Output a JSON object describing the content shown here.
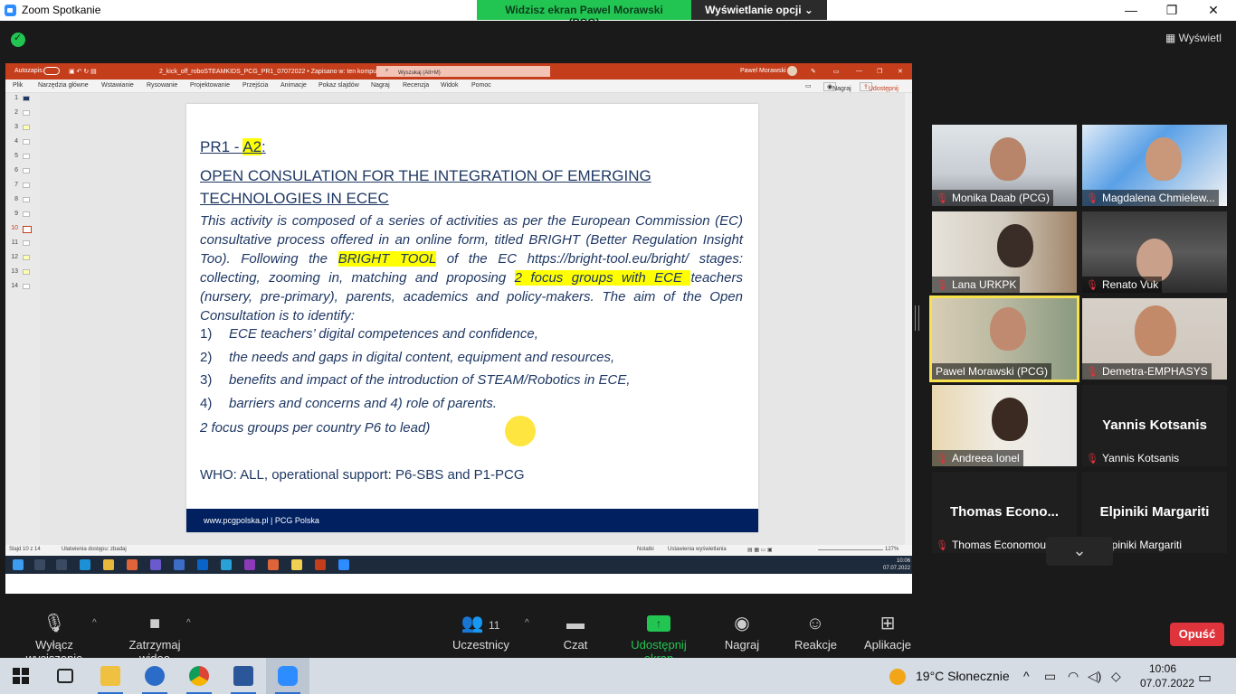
{
  "window": {
    "title": "Zoom Spotkanie",
    "minimize": "—",
    "restore": "❐",
    "close": "✕"
  },
  "share_banner": {
    "viewing": "Widzisz ekran Pawel Morawski (PCG)",
    "options": "Wyświetlanie opcji ⌄"
  },
  "view_toggle": "Wyświetl",
  "powerpoint": {
    "autosave": "Autozapis",
    "filename": "2_kick_off_roboSTEAMKIDS_PCG_PR1_07072022 • Zapisano w: ten komputer ⌄",
    "search_placeholder": "Wyszukaj (Alt+M)",
    "user": "Pawel Morawski",
    "menu": [
      "Plik",
      "Narzędzia główne",
      "Wstawianie",
      "Rysowanie",
      "Projektowanie",
      "Przejścia",
      "Animacje",
      "Pokaz slajdów",
      "Nagraj",
      "Recenzja",
      "Widok",
      "Pomoc"
    ],
    "record": "Nagraj",
    "share": "Udostępnij",
    "thumbnails": [
      "1",
      "2",
      "3",
      "4",
      "5",
      "6",
      "7",
      "8",
      "9",
      "10",
      "11",
      "12",
      "13",
      "14"
    ],
    "active_slide": "10",
    "status_left": "Slajd 10 z 14",
    "status_access": "Ułatwienia dostępu: zbadaj",
    "status_notes": "Notatki",
    "status_view": "Ustawienia wyświetlania",
    "zoom": "127%",
    "inner_clock_time": "10:06",
    "inner_clock_date": "07.07.2022"
  },
  "slide": {
    "title_prefix": "PR1 - ",
    "title_hl": "A2",
    "title_suffix": ":",
    "heading": "OPEN CONSULATION FOR THE INTEGRATION OF EMERGING TECHNOLOGIES IN ECEC",
    "body_1": "This activity is composed of a series of activities as per the European Commission (EC) consultative process offered in an online form, titled BRIGHT (Better Regulation Insight Too). Following the ",
    "body_hl1": "BRIGHT TOOL",
    "body_2": " of the EC https://bright-tool.eu/bright/ stages: collecting, zooming in, matching and proposing ",
    "body_hl2": "2 focus groups with ECE ",
    "body_3": "teachers (nursery, pre-primary), parents, academics and policy-makers. The aim of the Open Consultation is to identify:",
    "list": [
      {
        "num": "1)",
        "text": "ECE teachers’ digital competences and confidence,"
      },
      {
        "num": "2)",
        "text": "the needs and gaps in digital content, equipment and resources,"
      },
      {
        "num": "3)",
        "text": "benefits and impact of the introduction of STEAM/Robotics in ECE,"
      },
      {
        "num": "4)",
        "text": "barriers and concerns and 4) role of parents."
      }
    ],
    "focus_note": "2 focus groups per country P6 to lead)",
    "who": "WHO: ALL, operational support: P6-SBS and P1-PCG",
    "footer": "www.pcgpolska.pl | PCG Polska"
  },
  "participants": [
    {
      "label": "Monika Daab (PCG)",
      "muted": true
    },
    {
      "label": "Magdalena Chmielew...",
      "muted": true
    },
    {
      "label": "Lana URKPK",
      "muted": true
    },
    {
      "label": "Renato Vuk",
      "muted": true
    },
    {
      "label": "Pawel Morawski (PCG)",
      "muted": false,
      "active": true
    },
    {
      "label": "Demetra-EMPHASYS",
      "muted": true
    },
    {
      "label": "Andreea Ionel",
      "muted": true
    },
    {
      "label": "Yannis Kotsanis",
      "muted": true,
      "big": "Yannis Kotsanis"
    },
    {
      "label": "Thomas Economou",
      "muted": true,
      "big": "Thomas  Econo..."
    },
    {
      "label": "Elpiniki Margariti",
      "muted": true,
      "big": "Elpiniki Margariti"
    }
  ],
  "toolbar": {
    "mute": "Wyłącz wyciszenie",
    "video": "Zatrzymaj wideo",
    "participants": "Uczestnicy",
    "participants_count": "11",
    "chat": "Czat",
    "share": "Udostępnij ekran",
    "record": "Nagraj",
    "reactions": "Reakcje",
    "apps": "Aplikacje",
    "leave": "Opuść"
  },
  "taskbar": {
    "weather": "19°C  Słonecznie",
    "time": "10:06",
    "date": "07.07.2022"
  },
  "colors": {
    "accent_green": "#23c552",
    "leave_red": "#e0343c",
    "ppt_red": "#c43e1c",
    "slide_navy": "#002060",
    "highlight": "#ffff00"
  }
}
